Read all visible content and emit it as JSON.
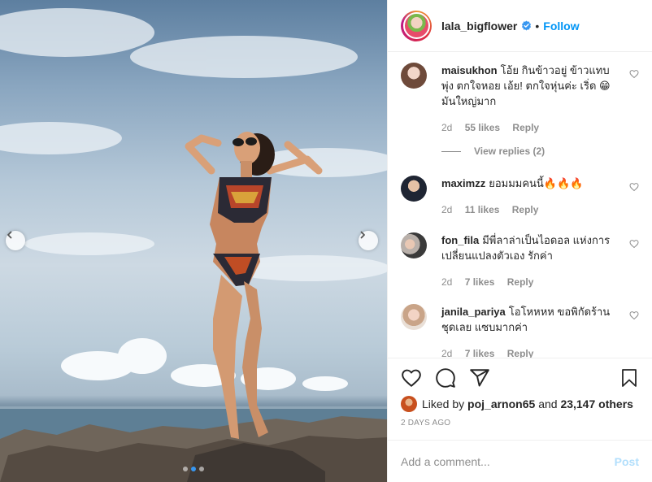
{
  "post": {
    "username": "lala_bigflower",
    "follow_label": "Follow",
    "separator": "•"
  },
  "comments": [
    {
      "user": "maisukhon",
      "text": "โอ้ย กินข้าวอยู่ ข้าวแทบพุ่ง ตกใจหอย เอ้ย! ตกใจหุ่นค่ะ เริ่ด 😁 มันใหญ่มาก",
      "age": "2d",
      "likes": "55 likes",
      "reply": "Reply",
      "view_replies": "View replies (2)"
    },
    {
      "user": "maximzz",
      "text": "ยอมมมคนนี้🔥🔥🔥",
      "age": "2d",
      "likes": "11 likes",
      "reply": "Reply"
    },
    {
      "user": "fon_fila",
      "text": "มีพี่ลาล่าเป็นไอดอล แห่งการเปลี่ยนแปลงตัวเอง รักค่า",
      "age": "2d",
      "likes": "7 likes",
      "reply": "Reply"
    },
    {
      "user": "janila_pariya",
      "text": "โอโหหหห ขอพิกัดร้านชุดเลย แซบมากค่า",
      "age": "2d",
      "likes": "7 likes",
      "reply": "Reply"
    }
  ],
  "likes": {
    "prefix": "Liked by",
    "user": "poj_arnon65",
    "conjunction": "and",
    "others": "23,147 others"
  },
  "timestamp": "2 DAYS AGO",
  "composer": {
    "placeholder": "Add a comment...",
    "post_label": "Post"
  },
  "carousel": {
    "total_slides": 3,
    "active_slide": 1
  },
  "colors": {
    "link": "#0095f6",
    "post_disabled": "#b2dffc",
    "verified": "#3897f0"
  },
  "icons": {
    "like": "heart-icon",
    "comment": "comment-icon",
    "share": "paper-plane-icon",
    "save": "bookmark-icon",
    "verified": "verified-badge-icon"
  }
}
